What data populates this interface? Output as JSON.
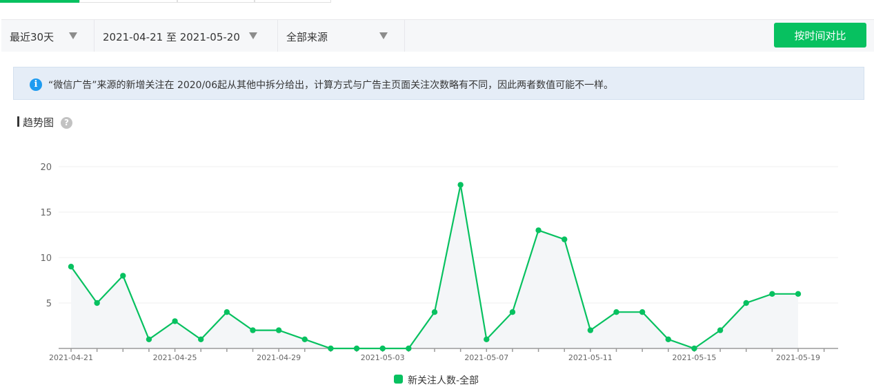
{
  "filters": {
    "range": "最近30天",
    "dates": "2021-04-21 至 2021-05-20",
    "source": "全部来源"
  },
  "compare_button": "按时间对比",
  "notice": "“微信广告”来源的新增关注在 2020/06起从其他中拆分给出，计算方式与广告主页面关注次数略有不同，因此两者数值可能不一样。",
  "section": {
    "title": "趋势图",
    "help": "?"
  },
  "colors": {
    "accent": "#07c160",
    "notice_bg": "#e5edf7"
  },
  "chart_data": {
    "type": "area",
    "x": [
      "2021-04-21",
      "2021-04-22",
      "2021-04-23",
      "2021-04-24",
      "2021-04-25",
      "2021-04-26",
      "2021-04-27",
      "2021-04-28",
      "2021-04-29",
      "2021-04-30",
      "2021-05-01",
      "2021-05-02",
      "2021-05-03",
      "2021-05-04",
      "2021-05-05",
      "2021-05-06",
      "2021-05-07",
      "2021-05-08",
      "2021-05-09",
      "2021-05-10",
      "2021-05-11",
      "2021-05-12",
      "2021-05-13",
      "2021-05-14",
      "2021-05-15",
      "2021-05-16",
      "2021-05-17",
      "2021-05-18",
      "2021-05-19"
    ],
    "series": [
      {
        "name": "新关注人数-全部",
        "values": [
          9,
          5,
          8,
          1,
          3,
          1,
          4,
          2,
          2,
          1,
          0,
          0,
          0,
          0,
          4,
          18,
          1,
          4,
          13,
          12,
          2,
          4,
          4,
          1,
          0,
          2,
          5,
          6,
          6
        ]
      }
    ],
    "x_tick_labels": [
      "2021-04-21",
      "2021-04-25",
      "2021-04-29",
      "2021-05-03",
      "2021-05-07",
      "2021-05-11",
      "2021-05-15",
      "2021-05-19"
    ],
    "y_ticks": [
      5,
      10,
      15,
      20
    ],
    "ylim": [
      0,
      20
    ],
    "grid": true,
    "legend": "bottom"
  }
}
